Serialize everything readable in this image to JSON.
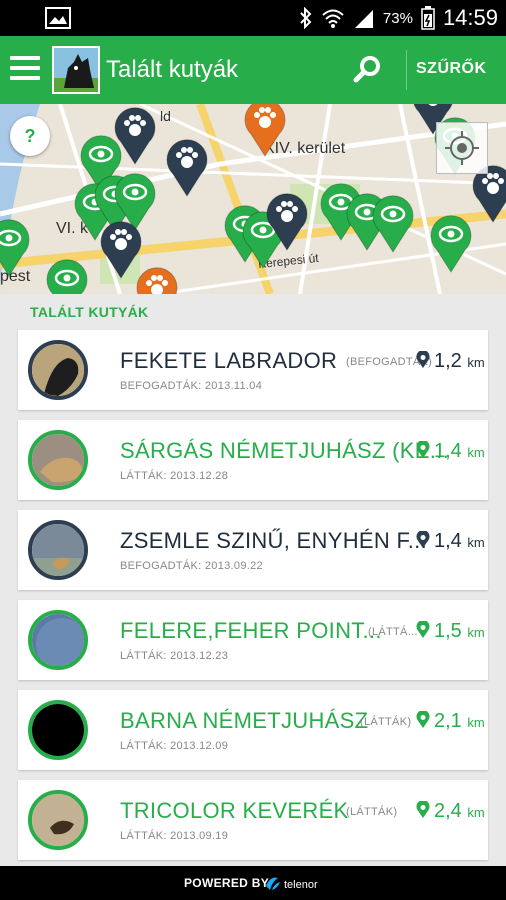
{
  "status_bar": {
    "battery": "73%",
    "time": "14:59",
    "icons": [
      "gallery-icon",
      "bluetooth-icon",
      "wifi-icon",
      "signal-icon",
      "battery-icon"
    ]
  },
  "app_bar": {
    "title": "Talált kutyák",
    "filter_label": "SZŰRŐK",
    "icons": [
      "menu-icon",
      "search-icon"
    ]
  },
  "map": {
    "labels": [
      "XIV. kerület",
      "VI. k",
      "pest",
      "Kerepesi út",
      "ld"
    ],
    "help_label": "?",
    "icons": [
      "help-icon",
      "locate-icon",
      "paw-pin-icon",
      "eye-pin-icon"
    ]
  },
  "list": {
    "header": "TALÁLT KUTYÁK",
    "items": [
      {
        "name": "FEKETE LABRADOR",
        "tag": "(BEFOGADTÁK)",
        "sub": "BEFOGADTÁK: 2013.11.04",
        "dist": "1,2",
        "unit": "km",
        "color": "dark"
      },
      {
        "name": "SÁRGÁS NÉMETJUHÁSZ (KE...",
        "tag": "",
        "sub": "LÁTTÁK: 2013.12.28",
        "dist": "1,4",
        "unit": "km",
        "color": "green"
      },
      {
        "name": "ZSEMLE SZINŰ,  ENYHÉN F...",
        "tag": "",
        "sub": "BEFOGADTÁK: 2013.09.22",
        "dist": "1,4",
        "unit": "km",
        "color": "dark"
      },
      {
        "name": "FELERE,FEHER POINT...",
        "tag": "(LÁTTÁ...",
        "sub": "LÁTTÁK: 2013.12.23",
        "dist": "1,5",
        "unit": "km",
        "color": "green"
      },
      {
        "name": "BARNA NÉMETJUHÁSZ",
        "tag": "(LÁTTÁK)",
        "sub": "LÁTTÁK: 2013.12.09",
        "dist": "2,1",
        "unit": "km",
        "color": "green"
      },
      {
        "name": "TRICOLOR KEVERÉK",
        "tag": "(LÁTTÁK)",
        "sub": "LÁTTÁK: 2013.09.19",
        "dist": "2,4",
        "unit": "km",
        "color": "green"
      }
    ]
  },
  "footer": {
    "powered_by": "POWERED BY",
    "brand": "telenor"
  },
  "colors": {
    "accent_green": "#27ae4a",
    "dark_navy": "#2d3e50",
    "paw_orange": "#e56f1f"
  }
}
